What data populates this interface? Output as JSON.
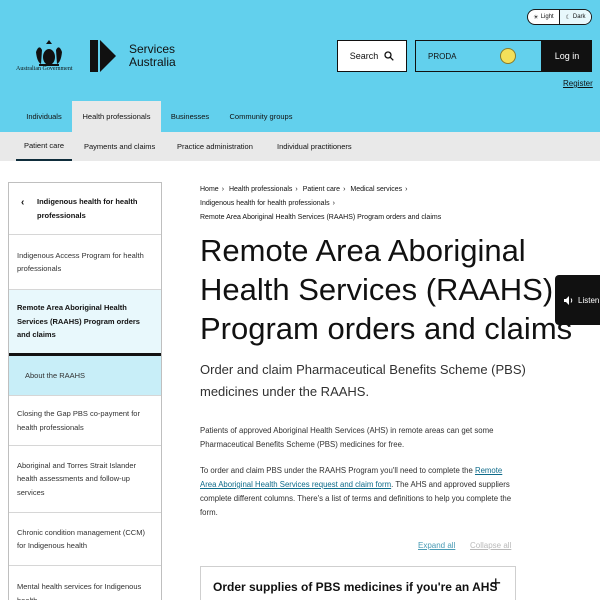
{
  "header": {
    "theme_light": "Light",
    "theme_dark": "Dark",
    "gov_label": "Australian Government",
    "brand_line1": "Services",
    "brand_line2": "Australia",
    "search_label": "Search",
    "proda_label": "PRODA",
    "login_label": "Log in",
    "register_label": "Register"
  },
  "primary_nav": [
    "Individuals",
    "Health professionals",
    "Businesses",
    "Community groups"
  ],
  "secondary_nav": [
    "Patient care",
    "Payments and claims",
    "Practice administration",
    "Individual practitioners"
  ],
  "sidebar": {
    "back_label": "Indigenous health for health professionals",
    "items": [
      "Indigenous Access Program for health professionals",
      "Remote Area Aboriginal Health Services (RAAHS) Program orders and claims",
      "About the RAAHS",
      "Closing the Gap PBS co-payment for health professionals",
      "Aboriginal and Torres Strait Islander health assessments and follow-up services",
      "Chronic condition management (CCM) for Indigenous health",
      "Mental health services for Indigenous health"
    ]
  },
  "breadcrumb": {
    "items": [
      "Home",
      "Health professionals",
      "Patient care",
      "Medical services",
      "Indigenous health for health professionals"
    ],
    "current": "Remote Area Aboriginal Health Services (RAAHS) Program orders and claims"
  },
  "main": {
    "title_lines": [
      "Remote Area Aboriginal",
      "Health Services (RAAHS)",
      "Program orders and claims"
    ],
    "lead": "Order and claim Pharmaceutical Benefits Scheme (PBS) medicines under the RAAHS.",
    "para1": "Patients of approved Aboriginal Health Services (AHS) in remote areas can get some Pharmaceutical Benefits Scheme (PBS) medicines for free.",
    "para2_before": "To order and claim PBS under the RAAHS Program you'll need to complete the ",
    "para2_link": "Remote Area Aboriginal Health Services request and claim form",
    "para2_after": ". The AHS and approved suppliers complete different columns. There's a list of terms and definitions to help you complete the form.",
    "expand_all": "Expand all",
    "collapse_all": "Collapse all",
    "accordion_title": "Order supplies of PBS medicines if you're an AHS"
  },
  "listen": {
    "label": "Listen"
  },
  "colors": {
    "brand": "#62d0ed",
    "nav_bg": "#e9e9e9",
    "text": "#313131",
    "link": "#0f6b8a"
  }
}
